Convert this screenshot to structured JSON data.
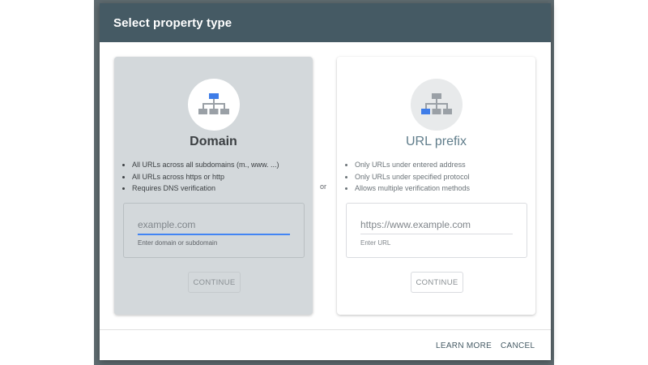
{
  "dialog": {
    "title": "Select property type"
  },
  "domain_card": {
    "title": "Domain",
    "bullets": [
      "All URLs across all subdomains (m., www. ...)",
      "All URLs across https or http",
      "Requires DNS verification"
    ],
    "input_placeholder": "example.com",
    "input_hint": "Enter domain or subdomain",
    "continue_label": "CONTINUE"
  },
  "separator": {
    "or_label": "or"
  },
  "url_card": {
    "title": "URL prefix",
    "bullets": [
      "Only URLs under entered address",
      "Only URLs under specified protocol",
      "Allows multiple verification methods"
    ],
    "input_placeholder": "https://www.example.com",
    "input_hint": "Enter URL",
    "continue_label": "CONTINUE"
  },
  "footer": {
    "learn_more_label": "LEARN MORE",
    "cancel_label": "CANCEL"
  },
  "icons": {
    "domain_icon": "sitemap-icon",
    "url_icon": "sitemap-icon"
  },
  "colors": {
    "header_bg": "#455a64",
    "accent_blue": "#4285f4",
    "selected_card_bg": "#d3d8db"
  }
}
